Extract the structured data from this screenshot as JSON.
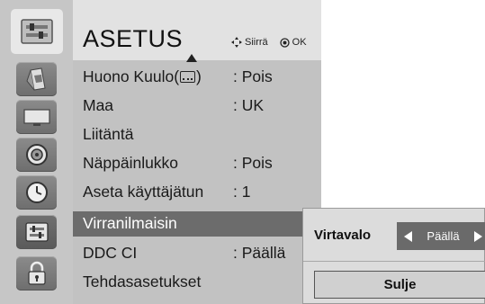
{
  "menu": {
    "title": "ASETUS",
    "nav_hint": {
      "move_icon": "four-way-arrow-icon",
      "move_label": "Siirrä",
      "ok_icon": "ok-dot-icon",
      "ok_label": "OK"
    },
    "items": [
      {
        "label_text": "Huono Kuulo(",
        "label_icon": "subtitle-icon",
        "label_suffix": ")",
        "value": ": Pois"
      },
      {
        "label": "Maa",
        "value": ": UK"
      },
      {
        "label": "Liitäntä",
        "value": ""
      },
      {
        "label": "Näppäinlukko",
        "value": ": Pois"
      },
      {
        "label": "Aseta käyttäjätun",
        "value": ": 1"
      },
      {
        "label": "Virranilmaisin",
        "value": "",
        "highlighted": true
      },
      {
        "label": "DDC CI",
        "value": ": Päällä"
      },
      {
        "label": "Tehdasasetukset",
        "value": ""
      }
    ]
  },
  "sidebar": {
    "icons": [
      {
        "name": "setup-icon",
        "selected": true
      },
      {
        "name": "picture-icon"
      },
      {
        "name": "tv-icon"
      },
      {
        "name": "audio-icon"
      },
      {
        "name": "time-icon"
      },
      {
        "name": "option-icon",
        "active": true
      },
      {
        "name": "lock-icon"
      }
    ]
  },
  "popup": {
    "label": "Virtavalo",
    "selected_value": "Päällä",
    "close_label": "Sulje"
  },
  "colors": {
    "highlight": "#6c6c6c",
    "panel": "#c2c2c2",
    "title_bg": "#e2e2e2"
  }
}
